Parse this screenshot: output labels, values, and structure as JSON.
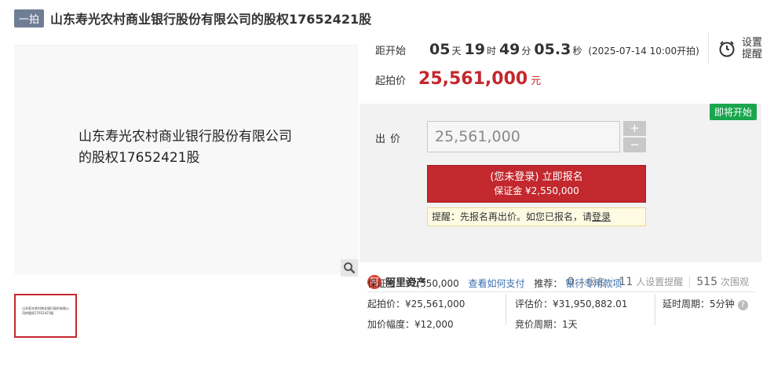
{
  "header": {
    "badge": "一拍",
    "title": "山东寿光农村商业银行股份有限公司的股权17652421股"
  },
  "image": {
    "text_line1": "山东寿光农村商业银行股份有限公司",
    "text_line2": "的股权17652421股",
    "thumb_text": "山东寿光农村商业银行股份有限公司的股权17652421股"
  },
  "countdown": {
    "label": "距开始",
    "days": "05",
    "days_unit": "天",
    "hours": "19",
    "hours_unit": "时",
    "minutes": "49",
    "minutes_unit": "分",
    "seconds": "05.3",
    "seconds_unit": "秒",
    "start_time": "(2025-07-14 10:00开拍)"
  },
  "reminder": {
    "label": "设置提醒",
    "icon": "alarm-clock-icon"
  },
  "start_price": {
    "label": "起拍价",
    "value": "25,561,000",
    "unit": "元",
    "color": "#c3282e"
  },
  "bid": {
    "status_tag": "即将开始",
    "label": "出价",
    "input_value": "25,561,000",
    "plus": "+",
    "minus": "−",
    "signup_line1": "(您未登录) 立即报名",
    "signup_line2": "保证金 ¥2,550,000",
    "hint_prefix": "提醒：先报名再出价。如您已报名，请",
    "hint_login": "登录"
  },
  "platform": {
    "icon_char": "阿",
    "name": "阿里资产"
  },
  "stats": [
    {
      "count": "0",
      "label": "人报名"
    },
    {
      "count": "11",
      "label": "人设置提醒"
    },
    {
      "count": "515",
      "label": "次围观"
    }
  ],
  "details": {
    "deposit": "保证金：¥2,550,000",
    "how_to_pay": "查看如何支付",
    "recommend_label": "推荐：",
    "recommend_link": "银行专用款项",
    "start_price": "起拍价：¥25,561,000",
    "increment": "加价幅度：¥12,000",
    "appraisal": "评估价：¥31,950,882.01",
    "bid_period": "竞价周期：1天",
    "delay_period": "延时周期：5分钟",
    "help_icon": "?"
  }
}
